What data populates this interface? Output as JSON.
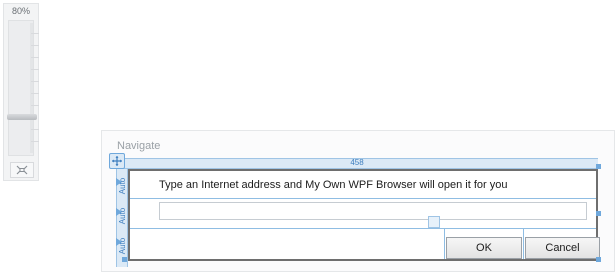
{
  "zoom": {
    "level": "80%"
  },
  "designer": {
    "title": "Navigate",
    "ruler": {
      "width": "458"
    },
    "rows": [
      "Auto",
      "Auto",
      "Auto"
    ],
    "prompt_text": "Type an Internet address and My Own WPF Browser will open it for you",
    "address_value": "",
    "ok_label": "OK",
    "cancel_label": "Cancel"
  },
  "colors": {
    "accent": "#6fa8dc",
    "border": "#6e6e6e"
  },
  "icons": [
    "fit-to-screen-icon",
    "move-icon",
    "center-marker-icon"
  ]
}
